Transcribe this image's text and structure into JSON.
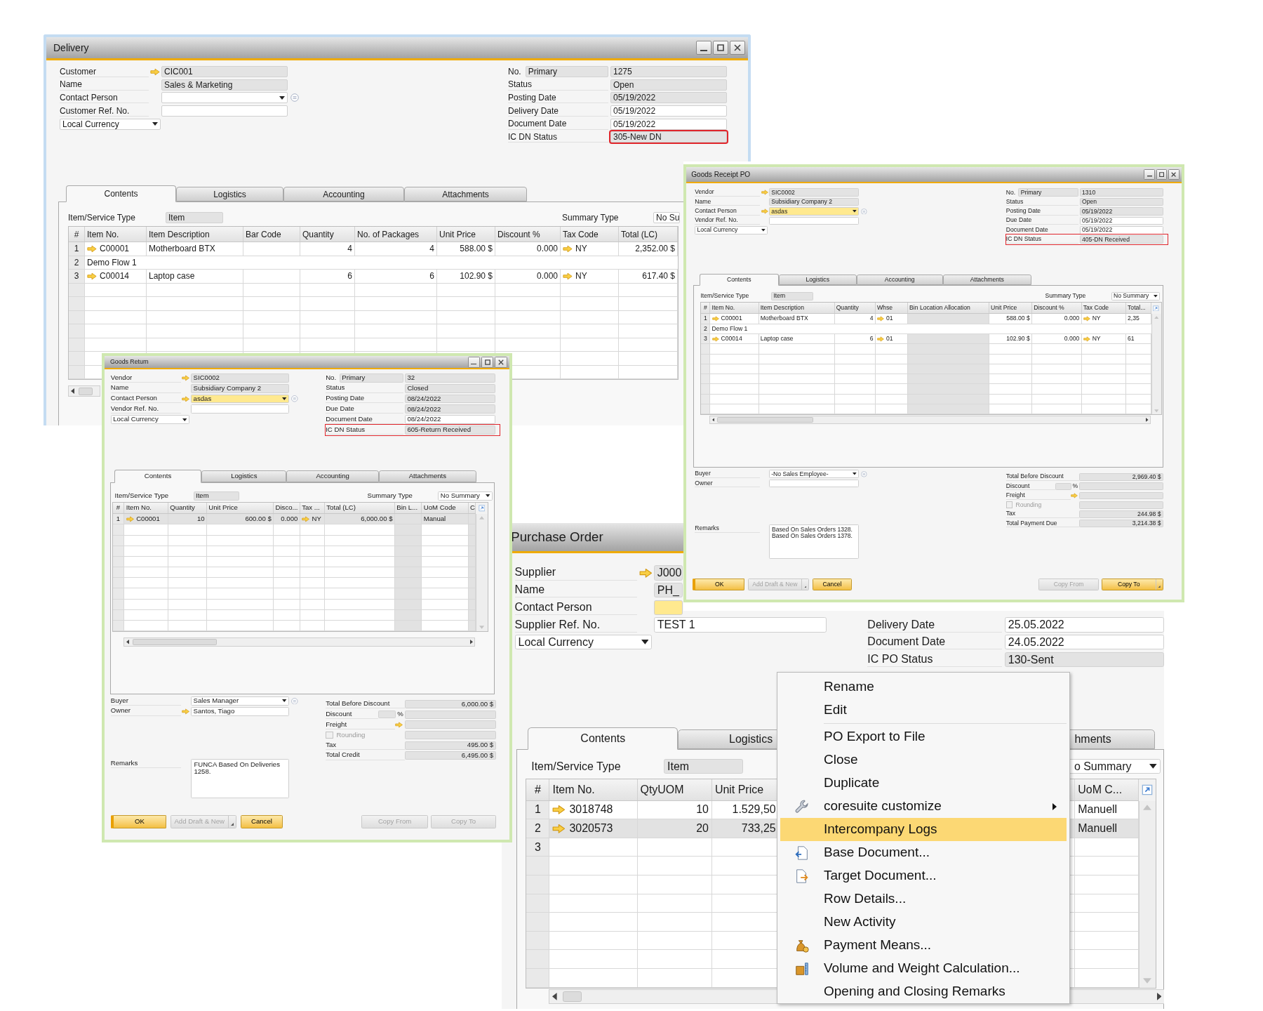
{
  "delivery": {
    "title": "Delivery",
    "header_left": [
      {
        "label": "Customer",
        "value": "CIC001",
        "kind": "readonly",
        "link": true
      },
      {
        "label": "Name",
        "value": "Sales & Marketing",
        "kind": "readonly",
        "link": false
      },
      {
        "label": "Contact Person",
        "kind": "dropdown",
        "link": false,
        "active": false,
        "info": true
      },
      {
        "label": "Customer Ref. No.",
        "kind": "input",
        "link": false
      },
      {
        "value": "Local Currency",
        "kind": "select",
        "link": false
      }
    ],
    "header_right": [
      {
        "label": "No.",
        "series": "Primary",
        "value": "1275",
        "kind": "readonly"
      },
      {
        "label": "Status",
        "value": "Open",
        "kind": "readonly"
      },
      {
        "label": "Posting Date",
        "value": "05/19/2022",
        "kind": "readonly"
      },
      {
        "label": "Delivery Date",
        "value": "05/19/2022",
        "kind": "input"
      },
      {
        "label": "Document Date",
        "value": "05/19/2022",
        "kind": "input"
      },
      {
        "label": "IC DN Status",
        "value": "305-New DN",
        "kind": "readonly",
        "highlighted": true
      }
    ],
    "tabs": [
      {
        "label": "Contents",
        "selected": true
      },
      {
        "label": "Logistics",
        "selected": false
      },
      {
        "label": "Accounting",
        "selected": false
      },
      {
        "label": "Attachments",
        "selected": false
      }
    ],
    "item_service_type": {
      "label": "Item/Service Type",
      "value": "Item"
    },
    "summary_type": {
      "label": "Summary Type",
      "value": "No Su"
    },
    "table": {
      "columns": [
        {
          "label": "#"
        },
        {
          "label": "Item No.",
          "link": true
        },
        {
          "label": "Item Description"
        },
        {
          "label": "Bar Code"
        },
        {
          "label": "Quantity"
        },
        {
          "label": "No. of Packages"
        },
        {
          "label": "Unit Price"
        },
        {
          "label": "Discount %"
        },
        {
          "label": "Tax Code",
          "link": true
        },
        {
          "label": "Total (LC)"
        }
      ],
      "rows": [
        {
          "kind": "item",
          "selected": false,
          "cells": [
            "1",
            "C00001",
            "Motherboard BTX",
            null,
            "4",
            "4",
            "588.00 $",
            "0.000",
            "NY",
            "2,352.00 $"
          ]
        },
        {
          "kind": "text",
          "selected": false,
          "cells": [
            "2",
            "Demo Flow 1"
          ]
        },
        {
          "kind": "item",
          "selected": false,
          "cells": [
            "3",
            "C00014",
            "Laptop case",
            null,
            "6",
            "6",
            "102.90 $",
            "0.000",
            "NY",
            "617.40 $"
          ]
        }
      ]
    }
  },
  "purchase_order": {
    "title": "Purchase Order",
    "header_left": [
      {
        "label": "Supplier",
        "value": "J000",
        "kind": "readonly",
        "link": true
      },
      {
        "label": "Name",
        "value": "PH_",
        "kind": "readonly",
        "link": false
      },
      {
        "label": "Contact Person",
        "kind": "dropdown",
        "link": false,
        "active": true,
        "info": false
      },
      {
        "label": "Supplier Ref. No.",
        "value": "TEST 1",
        "kind": "input",
        "link": false
      },
      {
        "value": "Local Currency",
        "kind": "select",
        "link": false
      }
    ],
    "header_right": [
      {
        "label": "Delivery Date",
        "value": "25.05.2022",
        "kind": "input"
      },
      {
        "label": "Document Date",
        "value": "24.05.2022",
        "kind": "input"
      },
      {
        "label": "IC PO Status",
        "value": "130-Sent",
        "kind": "readonly"
      }
    ],
    "tabs": [
      {
        "label": "Contents",
        "selected": true
      },
      {
        "label": "Logistics",
        "selected": false
      },
      {
        "label": "hments",
        "selected": false
      }
    ],
    "item_service_type": {
      "label": "Item/Service Type",
      "value": "Item"
    },
    "summary_type": {
      "value": "o Summary"
    },
    "table": {
      "columns": [
        {
          "label": "#"
        },
        {
          "label": "Item No.",
          "link": true
        },
        {
          "label": "QtyUOM"
        },
        {
          "label": "Unit Price"
        },
        {
          "label": "UoM C..."
        }
      ],
      "rows": [
        {
          "kind": "item",
          "selected": false,
          "cells": [
            "1",
            "3018748",
            "10",
            "1.529,50",
            "Manuell"
          ]
        },
        {
          "kind": "item",
          "selected": true,
          "cells": [
            "2",
            "3020573",
            "20",
            "733,25",
            "Manuell"
          ]
        },
        {
          "kind": "item",
          "selected": false,
          "cells": [
            "3",
            null,
            null,
            null,
            null
          ]
        }
      ]
    }
  },
  "goods_return": {
    "title": "Goods Return",
    "header_left": [
      {
        "label": "Vendor",
        "value": "SIC0002",
        "kind": "readonly",
        "link": true
      },
      {
        "label": "Name",
        "value": "Subsidiary Company 2",
        "kind": "readonly",
        "link": false
      },
      {
        "label": "Contact Person",
        "value": "asdas",
        "kind": "dropdown",
        "link": true,
        "active": true,
        "info": true
      },
      {
        "label": "Vendor Ref. No.",
        "kind": "input",
        "link": false
      },
      {
        "value": "Local Currency",
        "kind": "select",
        "link": false
      }
    ],
    "header_right": [
      {
        "label": "No.",
        "series": "Primary",
        "value": "32",
        "kind": "readonly"
      },
      {
        "label": "Status",
        "value": "Closed",
        "kind": "readonly"
      },
      {
        "label": "Posting Date",
        "value": "08/24/2022",
        "kind": "readonly"
      },
      {
        "label": "Due Date",
        "value": "08/24/2022",
        "kind": "readonly"
      },
      {
        "label": "Document Date",
        "value": "08/24/2022",
        "kind": "input"
      },
      {
        "label": "IC DN Status",
        "value": "605-Return Received",
        "kind": "readonly",
        "highlighted": true
      }
    ],
    "tabs": [
      {
        "label": "Contents",
        "selected": true
      },
      {
        "label": "Logistics",
        "selected": false
      },
      {
        "label": "Accounting",
        "selected": false
      },
      {
        "label": "Attachments",
        "selected": false
      }
    ],
    "item_service_type": {
      "label": "Item/Service Type",
      "value": "Item"
    },
    "summary_type": {
      "label": "Summary Type",
      "value": "No Summary"
    },
    "table": {
      "columns": [
        {
          "label": "#"
        },
        {
          "label": "Item No.",
          "link": true
        },
        {
          "label": "Quantity"
        },
        {
          "label": "Unit Price"
        },
        {
          "label": "Disco..."
        },
        {
          "label": "Tax ...",
          "link": true
        },
        {
          "label": "Total (LC)"
        },
        {
          "label": "Bin L...",
          "disabled": true
        },
        {
          "label": "UoM Code"
        },
        {
          "label": "C",
          "disabled": true
        }
      ],
      "rows": [
        {
          "kind": "item",
          "selected": true,
          "cells": [
            "1",
            "C00001",
            "10",
            "600.00 $",
            "0.000",
            "NY",
            "6,000.00 $",
            null,
            "Manual",
            null
          ]
        }
      ]
    },
    "footer": {
      "left": [
        {
          "label": "Buyer",
          "value": "Sales Manager",
          "kind": "dropdown",
          "link": false,
          "active": false,
          "info": true
        },
        {
          "label": "Owner",
          "value": "Santos, Tiago",
          "kind": "input",
          "link": true
        },
        {
          "label": "Remarks",
          "value": "FUNCA Based On Deliveries 1258.",
          "kind": "textarea",
          "link": false
        }
      ],
      "right": [
        {
          "label": "Total Before Discount",
          "value": "6,000.00 $",
          "kind": "total"
        },
        {
          "label": "Discount",
          "unit": "%",
          "kind": "discount"
        },
        {
          "label": "Freight",
          "kind": "freight",
          "link": true
        },
        {
          "label": "Rounding",
          "kind": "rounding",
          "checked": false,
          "disabled": true
        },
        {
          "label": "Tax",
          "value": "495.00 $",
          "kind": "total"
        },
        {
          "label": "Total Credit",
          "value": "6,495.00 $",
          "kind": "total"
        }
      ]
    },
    "buttons_left": [
      {
        "label": "OK",
        "disabled": false,
        "default": true,
        "split": false
      },
      {
        "label": "Add Draft & New",
        "disabled": true,
        "default": false,
        "split": true
      },
      {
        "label": "Cancel",
        "disabled": false,
        "default": false,
        "split": false
      }
    ],
    "buttons_right": [
      {
        "label": "Copy From",
        "disabled": true,
        "default": false,
        "split": false
      },
      {
        "label": "Copy To",
        "disabled": true,
        "default": false,
        "split": false
      }
    ]
  },
  "goods_receipt_po": {
    "title": "Goods Receipt PO",
    "header_left": [
      {
        "label": "Vendor",
        "value": "SIC0002",
        "kind": "readonly",
        "link": true
      },
      {
        "label": "Name",
        "value": "Subsidiary Company 2",
        "kind": "readonly",
        "link": false
      },
      {
        "label": "Contact Person",
        "value": "asdas",
        "kind": "dropdown",
        "link": true,
        "active": true,
        "info": true
      },
      {
        "label": "Vendor Ref. No.",
        "kind": "input",
        "link": false
      },
      {
        "value": "Local Currency",
        "kind": "select",
        "link": false
      }
    ],
    "header_right": [
      {
        "label": "No.",
        "series": "Primary",
        "value": "1310",
        "kind": "readonly"
      },
      {
        "label": "Status",
        "value": "Open",
        "kind": "readonly"
      },
      {
        "label": "Posting Date",
        "value": "05/19/2022",
        "kind": "readonly"
      },
      {
        "label": "Due Date",
        "value": "05/19/2022",
        "kind": "input"
      },
      {
        "label": "Document Date",
        "value": "05/19/2022",
        "kind": "input"
      },
      {
        "label": "IC DN Status",
        "value": "405-DN Received",
        "kind": "readonly",
        "highlighted": true
      }
    ],
    "tabs": [
      {
        "label": "Contents",
        "selected": true
      },
      {
        "label": "Logistics",
        "selected": false
      },
      {
        "label": "Accounting",
        "selected": false
      },
      {
        "label": "Attachments",
        "selected": false
      }
    ],
    "item_service_type": {
      "label": "Item/Service Type",
      "value": "Item"
    },
    "summary_type": {
      "label": "Summary Type",
      "value": "No Summary"
    },
    "table": {
      "columns": [
        {
          "label": "#"
        },
        {
          "label": "Item No.",
          "link": true
        },
        {
          "label": "Item Description"
        },
        {
          "label": "Quantity"
        },
        {
          "label": "Whse",
          "link": true
        },
        {
          "label": "Bin Location Allocation",
          "disabled": true
        },
        {
          "label": "Unit Price"
        },
        {
          "label": "Discount %"
        },
        {
          "label": "Tax Code",
          "link": true
        },
        {
          "label": "Total..."
        }
      ],
      "rows": [
        {
          "kind": "item",
          "selected": false,
          "cells": [
            "1",
            "C00001",
            "Motherboard BTX",
            "4",
            "01",
            null,
            "588.00 $",
            "0.000",
            "NY",
            "2,35"
          ]
        },
        {
          "kind": "text",
          "selected": false,
          "cells": [
            "2",
            "Demo Flow 1"
          ]
        },
        {
          "kind": "item",
          "selected": false,
          "cells": [
            "3",
            "C00014",
            "Laptop case",
            "6",
            "01",
            null,
            "102.90 $",
            "0.000",
            "NY",
            "61"
          ]
        }
      ]
    },
    "footer": {
      "left": [
        {
          "label": "Buyer",
          "value": "-No Sales Employee-",
          "kind": "dropdown",
          "link": false,
          "active": false,
          "info": true
        },
        {
          "label": "Owner",
          "kind": "input",
          "link": false
        },
        {
          "label": "Remarks",
          "value": "Based On Sales Orders 1328.\nBased On Sales Orders 1378.",
          "kind": "textarea",
          "link": false
        }
      ],
      "right": [
        {
          "label": "Total Before Discount",
          "value": "2,969.40 $",
          "kind": "total"
        },
        {
          "label": "Discount",
          "unit": "%",
          "kind": "discount"
        },
        {
          "label": "Freight",
          "kind": "freight",
          "link": true
        },
        {
          "label": "Rounding",
          "kind": "rounding",
          "checked": false,
          "disabled": true
        },
        {
          "label": "Tax",
          "value": "244.98 $",
          "kind": "total"
        },
        {
          "label": "Total Payment Due",
          "value": "3,214.38 $",
          "kind": "total"
        }
      ]
    },
    "buttons_left": [
      {
        "label": "OK",
        "disabled": false,
        "default": true,
        "split": false
      },
      {
        "label": "Add Draft & New",
        "disabled": true,
        "default": false,
        "split": true
      },
      {
        "label": "Cancel",
        "disabled": false,
        "default": false,
        "split": false
      }
    ],
    "buttons_right": [
      {
        "label": "Copy From",
        "disabled": true,
        "default": false,
        "split": false
      },
      {
        "label": "Copy To",
        "disabled": false,
        "default": false,
        "split": true
      }
    ]
  },
  "context_menu": {
    "items": [
      {
        "label": "Rename",
        "selected": false,
        "submenu": false
      },
      {
        "label": "Edit",
        "selected": false,
        "submenu": false
      },
      {
        "label": "PO Export to File",
        "selected": false,
        "submenu": false
      },
      {
        "label": "Close",
        "selected": false,
        "submenu": false
      },
      {
        "label": "Duplicate",
        "selected": false,
        "submenu": false
      },
      {
        "label": "coresuite customize",
        "selected": false,
        "submenu": true
      },
      {
        "label": "Intercompany Logs",
        "selected": true,
        "submenu": false
      },
      {
        "label": "Base Document...",
        "selected": false,
        "submenu": false
      },
      {
        "label": "Target Document...",
        "selected": false,
        "submenu": false
      },
      {
        "label": "Row Details...",
        "selected": false,
        "submenu": false
      },
      {
        "label": "New Activity",
        "selected": false,
        "submenu": false
      },
      {
        "label": "Payment Means...",
        "selected": false,
        "submenu": false
      },
      {
        "label": "Volume and Weight Calculation...",
        "selected": false,
        "submenu": false
      },
      {
        "label": "Opening and Closing Remarks",
        "selected": false,
        "submenu": false
      }
    ]
  }
}
